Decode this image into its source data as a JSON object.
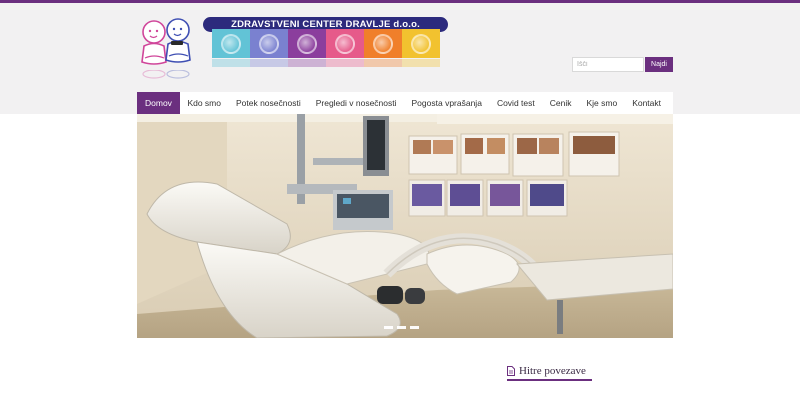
{
  "logo": {
    "title": "ZDRAVSTVENI CENTER DRAVLJE d.o.o.",
    "tile_colors": [
      "#62c3d6",
      "#7a81d0",
      "#8b3e9d",
      "#e65a8a",
      "#f07f2a",
      "#f2c22f"
    ]
  },
  "search": {
    "placeholder": "Išči",
    "button_label": "Najdi"
  },
  "nav": {
    "items": [
      {
        "label": "Domov",
        "active": true
      },
      {
        "label": "Kdo smo"
      },
      {
        "label": "Potek nosečnosti"
      },
      {
        "label": "Pregledi v nosečnosti"
      },
      {
        "label": "Pogosta vprašanja"
      },
      {
        "label": "Covid test"
      },
      {
        "label": "Cenik"
      },
      {
        "label": "Kje smo"
      },
      {
        "label": "Kontakt"
      }
    ]
  },
  "hero": {
    "slides_count": 3,
    "active_slide": 3
  },
  "quick_links": {
    "icon": "document-icon",
    "label": "Hitre povezave"
  },
  "colors": {
    "accent": "#6b2f7f",
    "header_bg": "#f2f1f2"
  }
}
